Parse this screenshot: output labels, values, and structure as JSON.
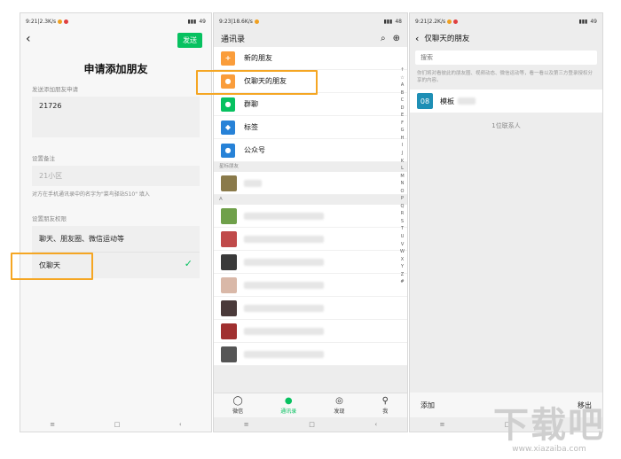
{
  "panel1": {
    "status_left": "9:21|2.3K/s",
    "status_right": "49",
    "send_label": "发送",
    "title": "申请添加朋友",
    "request_label": "发送添加朋友申请",
    "request_value": "21726",
    "remark_label": "设置备注",
    "remark_value": "21小区",
    "remark_hint": "对方在手机通讯录中的名字为\"菜鸟驿站510\" 填入",
    "perm_label": "设置朋友权限",
    "perm_option1": "聊天、朋友圈、微信运动等",
    "perm_option2": "仅聊天"
  },
  "panel2": {
    "status_left": "9:23|18.6K/s",
    "status_right": "48",
    "header_title": "通讯录",
    "items": [
      {
        "label": "新的朋友",
        "color": "#fa9d3b"
      },
      {
        "label": "仅聊天的朋友",
        "color": "#fa9d3b"
      },
      {
        "label": "群聊",
        "color": "#07c160"
      },
      {
        "label": "标签",
        "color": "#2782d7"
      },
      {
        "label": "公众号",
        "color": "#2782d7"
      }
    ],
    "group_starred": "星标朋友",
    "group_a": "A",
    "alphabet": [
      "↑",
      "☆",
      "A",
      "B",
      "C",
      "D",
      "E",
      "F",
      "G",
      "H",
      "I",
      "J",
      "K",
      "L",
      "M",
      "N",
      "O",
      "P",
      "Q",
      "R",
      "S",
      "T",
      "U",
      "V",
      "W",
      "X",
      "Y",
      "Z",
      "#"
    ],
    "tabs": [
      {
        "label": "微信",
        "icon": "chat-icon"
      },
      {
        "label": "通讯录",
        "icon": "contacts-icon"
      },
      {
        "label": "发现",
        "icon": "compass-icon"
      },
      {
        "label": "我",
        "icon": "person-icon"
      }
    ]
  },
  "panel3": {
    "status_left": "9:21|2.2K/s",
    "status_right": "49",
    "header_title": "仅聊天的朋友",
    "search_placeholder": "搜索",
    "desc": "你们将对看彼此的朋友圈、视频动态、微信运动等，看一看以及第三方登录授权分享的内容。",
    "contact_num": "08",
    "contact_name": "模板",
    "count_text": "1位联系人",
    "add_label": "添加",
    "remove_label": "移出"
  },
  "watermark": {
    "big": "下载吧",
    "small": "www.xiazaiba.com"
  }
}
